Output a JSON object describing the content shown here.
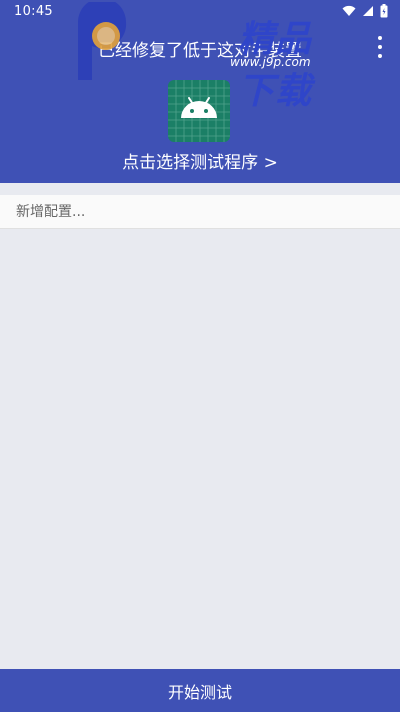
{
  "status_bar": {
    "time": "10:45",
    "icons": [
      "wifi-icon",
      "signal-icon",
      "battery-icon"
    ]
  },
  "header": {
    "title": "已经修复了低于这对手装置",
    "select_label": "点击选择测试程序 >",
    "app_icon": "android-icon"
  },
  "watermark": {
    "text": "精品下载",
    "url": "www.j9p.com"
  },
  "config": {
    "placeholder": "新增配置..."
  },
  "footer": {
    "start_label": "开始测试"
  },
  "colors": {
    "primary": "#3f51b5",
    "background": "#e8eaf0",
    "icon_bg": "#1b7f66"
  }
}
